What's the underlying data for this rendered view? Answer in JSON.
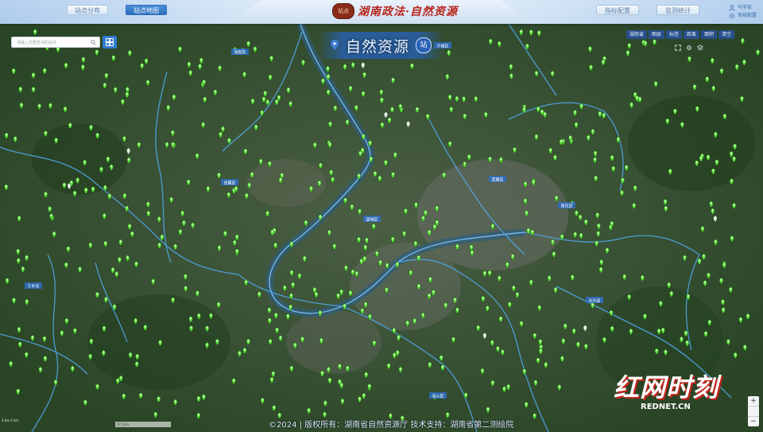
{
  "header": {
    "nav_left": [
      "站点分布",
      "站点地图"
    ],
    "nav_right": [
      "指标配置",
      "监测统计"
    ],
    "logo_badge": "站点",
    "logo_title": "湖南政法·自然资源",
    "user_name": "马宇安",
    "settings_label": "系统配置"
  },
  "search": {
    "placeholder": "请输入您要查询的站点"
  },
  "station_banner": {
    "title": "自然资源",
    "seal": "站"
  },
  "toolbar": [
    "湖南省",
    "图层",
    "标签",
    "距离",
    "面积",
    "清空"
  ],
  "district_labels": [
    "开福区",
    "岳麓区",
    "望城区",
    "芙蓉区",
    "雨花区",
    "天心区",
    "长沙县",
    "浏阳市",
    "宁乡市"
  ],
  "footer": {
    "copyright": "©2024  |  版权所有：湖南省自然资源厅  技术支持：湖南省第二测绘院"
  },
  "watermark": {
    "brand": "红网时刻",
    "site": "REDNET.CN"
  },
  "zoom": {
    "plus": "+",
    "minus": "−"
  },
  "scale": {
    "text": "0     5 km",
    "left_text": "3 km\n2 km"
  },
  "colors": {
    "marker": "#5de33a",
    "river": "#6fb7f2",
    "boundary": "#4fa6e6",
    "brand_red": "#d6281f"
  }
}
